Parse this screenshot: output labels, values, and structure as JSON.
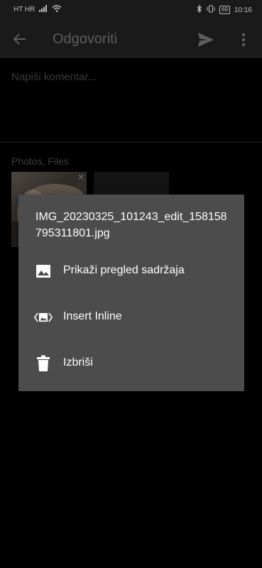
{
  "status_bar": {
    "carrier": "HT HR",
    "time": "10:16",
    "battery": "69"
  },
  "app_bar": {
    "title": "Odgovoriti"
  },
  "compose": {
    "placeholder": "Napiši komentar..."
  },
  "attachments": {
    "section_label": "Photos, Files",
    "close_glyph": "✕"
  },
  "dialog": {
    "title": "IMG_20230325_101243_edit_158158795311801.jpg",
    "items": [
      {
        "label": "Prikaži pregled sadržaja",
        "icon": "image-icon"
      },
      {
        "label": "Insert Inline",
        "icon": "inline-image-icon"
      },
      {
        "label": "Izbriši",
        "icon": "trash-icon"
      }
    ]
  }
}
